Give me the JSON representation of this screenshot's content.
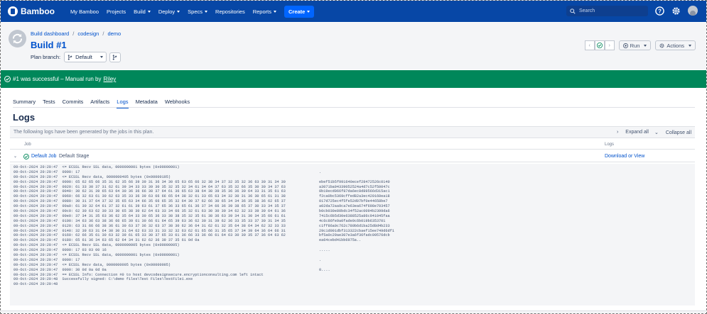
{
  "app": {
    "name": "Bamboo"
  },
  "nav": {
    "items": [
      "My Bamboo",
      "Projects",
      "Build",
      "Deploy",
      "Specs",
      "Repositories",
      "Reports"
    ],
    "create_label": "Create",
    "search_placeholder": "Search"
  },
  "header": {
    "breadcrumb": [
      "Build dashboard",
      "codesign",
      "demo"
    ],
    "title": "Build #1",
    "plan_branch_label": "Plan branch:",
    "plan_branch_value": "Default",
    "run_label": "Run",
    "actions_label": "Actions"
  },
  "status": {
    "text": "#1 was successful – Manual run by",
    "user": "Riley",
    "color": "#00875a"
  },
  "tabs": [
    {
      "label": "Summary",
      "active": false
    },
    {
      "label": "Tests",
      "active": false
    },
    {
      "label": "Commits",
      "active": false
    },
    {
      "label": "Artifacts",
      "active": false
    },
    {
      "label": "Logs",
      "active": true
    },
    {
      "label": "Metadata",
      "active": false
    },
    {
      "label": "Webhooks",
      "active": false
    }
  ],
  "logs": {
    "heading": "Logs",
    "info": "The following logs have been generated by the jobs in this plan.",
    "expand_all": "Expand all",
    "collapse_all": "Collapse all",
    "col_job": "Job",
    "col_logs": "Logs",
    "job_name": "Default Job",
    "job_stage": "Default Stage",
    "download_label": "Download or View",
    "lines": [
      {
        "t": "09-Oct-2024 20:20:47  <= ECSSL Recv SSL data, 0000000001 bytes (0x00000001)",
        "h": ""
      },
      {
        "t": "09-Oct-2024 20:20:47  0000: 17",
        "h": "."
      },
      {
        "t": "09-Oct-2024 20:20:47  <= ECSSL Recv data, 0000000405 bytes (0x00000195)",
        "h": ""
      },
      {
        "t": "09-Oct-2024 20:20:47  0000: 65 62 65 66 35 31 62 35 66 39 39 31 36 34 30 65 63 65 66 32 38 34 37 32 35 32 36 63 30 31 34 30",
        "h": "ebef51b5f991640ecef28472526c0140"
      },
      {
        "t": "09-Oct-2024 20:20:47  0020: 61 33 30 37 31 62 61 39 34 33 33 39 30 35 32 35 32 34 61 34 64 37 63 35 32 66 35 30 30 34 37 63",
        "h": "a3071ba94339052524a4d7c52f50047c"
      },
      {
        "t": "09-Oct-2024 20:20:47  0040: 30 62 31 39 65 63 64 30 36 36 66 38 37 64 61 36 65 63 38 64 38 39 35 36 36 39 64 33 31 35 61 63",
        "h": "0b19ecd066f87da6ec8d89566d315ac1"
      },
      {
        "t": "09-Oct-2024 20:20:47  0060: 66 32 63 61 30 62 63 35 33 36 39 63 66 66 65 64 38 32 61 33 65 63 34 32 30 31 36 30 65 61 31 38",
        "h": "f2ca0bc5369cffed82a3ec420160ea18"
      },
      {
        "t": "09-Oct-2024 20:20:47  0080: 30 31 37 64 37 32 35 65 63 34 66 35 66 65 35 32 64 30 37 62 66 30 65 34 34 36 35 38 36 62 65 37",
        "h": "017d725ec4f5fe52d07bf0e44658be7"
      },
      {
        "t": "09-Oct-2024 20:20:47  00a0: 61 30 32 64 61 37 32 61 61 39 63 61 37 65 36 33 65 61 36 37 34 66 36 39 38 65 37 30 33 34 35 37",
        "h": "a02da72aa9ca7e63ea674f698e703457"
      },
      {
        "t": "09-Oct-2024 20:20:47  00c0: 62 30 63 62 30 33 30 65 38 30 62 64 63 33 34 66 35 32 61 63 30 30 39 34 62 32 33 39 39 64 61 36",
        "h": "b0cb030e80bdc34f52ac0094b2399da6"
      },
      {
        "t": "09-Oct-2024 20:20:47  00e0: 37 34 31 35 63 36 62 35 64 33 30 65 36 33 38 38 35 32 35 61 38 36 63 39 34 31 30 34 35 66 61 61",
        "h": "7415c6b5d30e6388525a86c941045faa"
      },
      {
        "t": "09-Oct-2024 20:20:47  0100: 34 63 36 63 38 36 66 65 39 61 30 66 61 64 65 39 63 36 62 30 31 39 62 36 33 35 33 37 30 31 34 35",
        "h": "4c6c86fe9a0fade9c6b019b6353701"
      },
      {
        "t": "09-Oct-2024 20:20:47  0120: 63 31 66 66 38 36 61 30 63 37 36 32 63 37 38 30 62 36 64 31 62 61 32 35 64 38 64 34 62 32 33 33",
        "h": "c1ff86a0c762c780b6d1ba25d8d4b233"
      },
      {
        "t": "09-Oct-2024 20:20:47  0140: 32 39 63 31 64 30 30 31 64 62 63 33 31 33 32 32 63 62 61 65 66 31 35 65 37 34 39 64 36 64 66 31",
        "h": "29c1d001dbf313322cbaef15ee749d6df1"
      },
      {
        "t": "09-Oct-2024 20:20:47  0160: 62 66 35 61 30 63 32 39 61 65 33 30 37 65 33 61 36 66 33 36 66 61 64 63 30 39 35 37 36 64 63 62",
        "h": "bf5a0c29ae307e3a6f36fadc09576dcb"
      },
      {
        "t": "09-Oct-2024 20:20:47  0180: 65 61 36 34 63 65 62 64 34 31 62 62 36 39 37 35 61 0d 0a",
        "h": "ea64cebd41bb6975a.."
      },
      {
        "t": "09-Oct-2024 20:20:47  <= ECSSL Recv SSL data, 0000000005 bytes (0x00000005)",
        "h": ""
      },
      {
        "t": "09-Oct-2024 20:20:47  0000: 17 03 03 00 16",
        "h": "....."
      },
      {
        "t": "09-Oct-2024 20:20:47  <= ECSSL Recv SSL data, 0000000001 bytes (0x00000001)",
        "h": ""
      },
      {
        "t": "09-Oct-2024 20:20:47  0000: 17",
        "h": "."
      },
      {
        "t": "09-Oct-2024 20:20:47  <= ECSSL Recv data, 0000000005 bytes (0x00000005)",
        "h": ""
      },
      {
        "t": "09-Oct-2024 20:20:47  0000: 30 0d 0a 0d 0a",
        "h": "0...."
      },
      {
        "t": "09-Oct-2024 20:20:47  == ECSSL Info: Connection #0 to host devcodesignsecure.encryptionconsulting.com left intact",
        "h": ""
      },
      {
        "t": "09-Oct-2024 20:20:48  Successfully signed: C:\\demo files\\Test Files\\TestFile1.exe",
        "h": ""
      },
      {
        "t": "09-Oct-2024 20:20:48",
        "h": ""
      }
    ]
  },
  "colors": {
    "nav": "#0747a6",
    "link": "#0052cc",
    "success": "#00875a"
  }
}
